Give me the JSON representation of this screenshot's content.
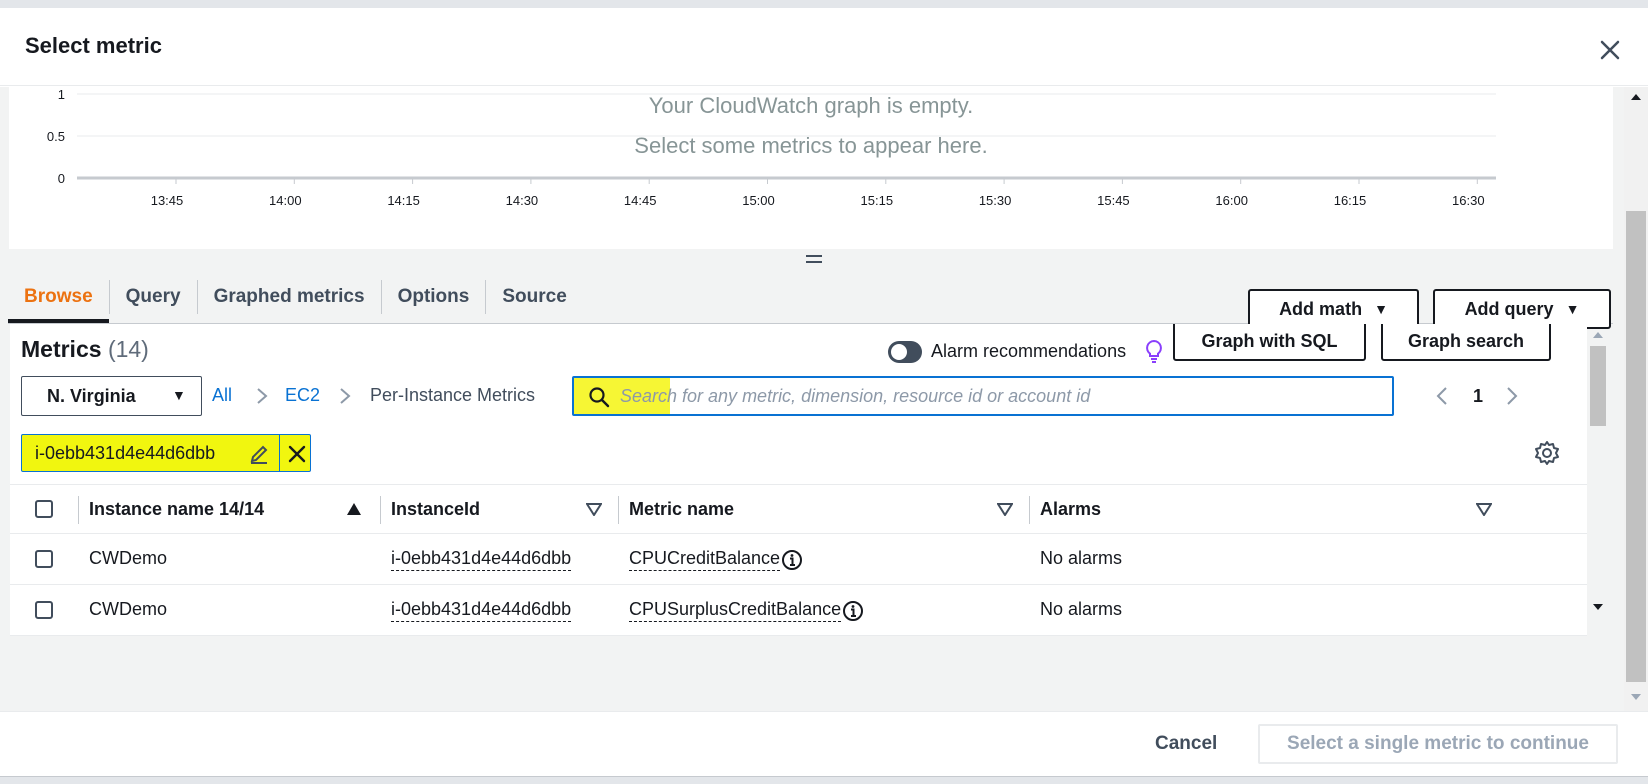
{
  "modal": {
    "title": "Select metric"
  },
  "graph": {
    "empty_line1": "Your CloudWatch graph is empty.",
    "empty_line2": "Select some metrics to appear here.",
    "y_ticks": [
      "1",
      "0.5",
      "0"
    ],
    "x_ticks": [
      "13:45",
      "14:00",
      "14:15",
      "14:30",
      "14:45",
      "15:00",
      "15:15",
      "15:30",
      "15:45",
      "16:00",
      "16:15",
      "16:30"
    ]
  },
  "tabs": [
    {
      "label": "Browse",
      "active": true
    },
    {
      "label": "Query",
      "active": false
    },
    {
      "label": "Graphed metrics",
      "active": false
    },
    {
      "label": "Options",
      "active": false
    },
    {
      "label": "Source",
      "active": false
    }
  ],
  "actions": {
    "add_math": "Add math",
    "add_query": "Add query"
  },
  "metrics": {
    "title": "Metrics",
    "count": "(14)",
    "alarm_recommendations": "Alarm recommendations",
    "alarm_toggle_on": false,
    "graph_with_sql": "Graph with SQL",
    "graph_search": "Graph search"
  },
  "filter": {
    "region": "N. Virginia",
    "breadcrumb": [
      "All",
      "EC2",
      "Per-Instance Metrics"
    ],
    "search_placeholder": "Search for any metric, dimension, resource id or account id",
    "search_value": "",
    "page": "1",
    "token": "i-0ebb431d4e44d6dbb"
  },
  "table": {
    "columns": [
      "Instance name 14/14",
      "InstanceId",
      "Metric name",
      "Alarms"
    ],
    "rows": [
      {
        "instance_name": "CWDemo",
        "instance_id": "i-0ebb431d4e44d6dbb",
        "metric_name": "CPUCreditBalance",
        "alarms": "No alarms"
      },
      {
        "instance_name": "CWDemo",
        "instance_id": "i-0ebb431d4e44d6dbb",
        "metric_name": "CPUSurplusCreditBalance",
        "alarms": "No alarms"
      }
    ]
  },
  "footer": {
    "cancel": "Cancel",
    "continue": "Select a single metric to continue"
  },
  "colors": {
    "accent": "#ec7211",
    "link": "#0972d3",
    "highlight": "#f1f60f",
    "text": "#16191f"
  }
}
